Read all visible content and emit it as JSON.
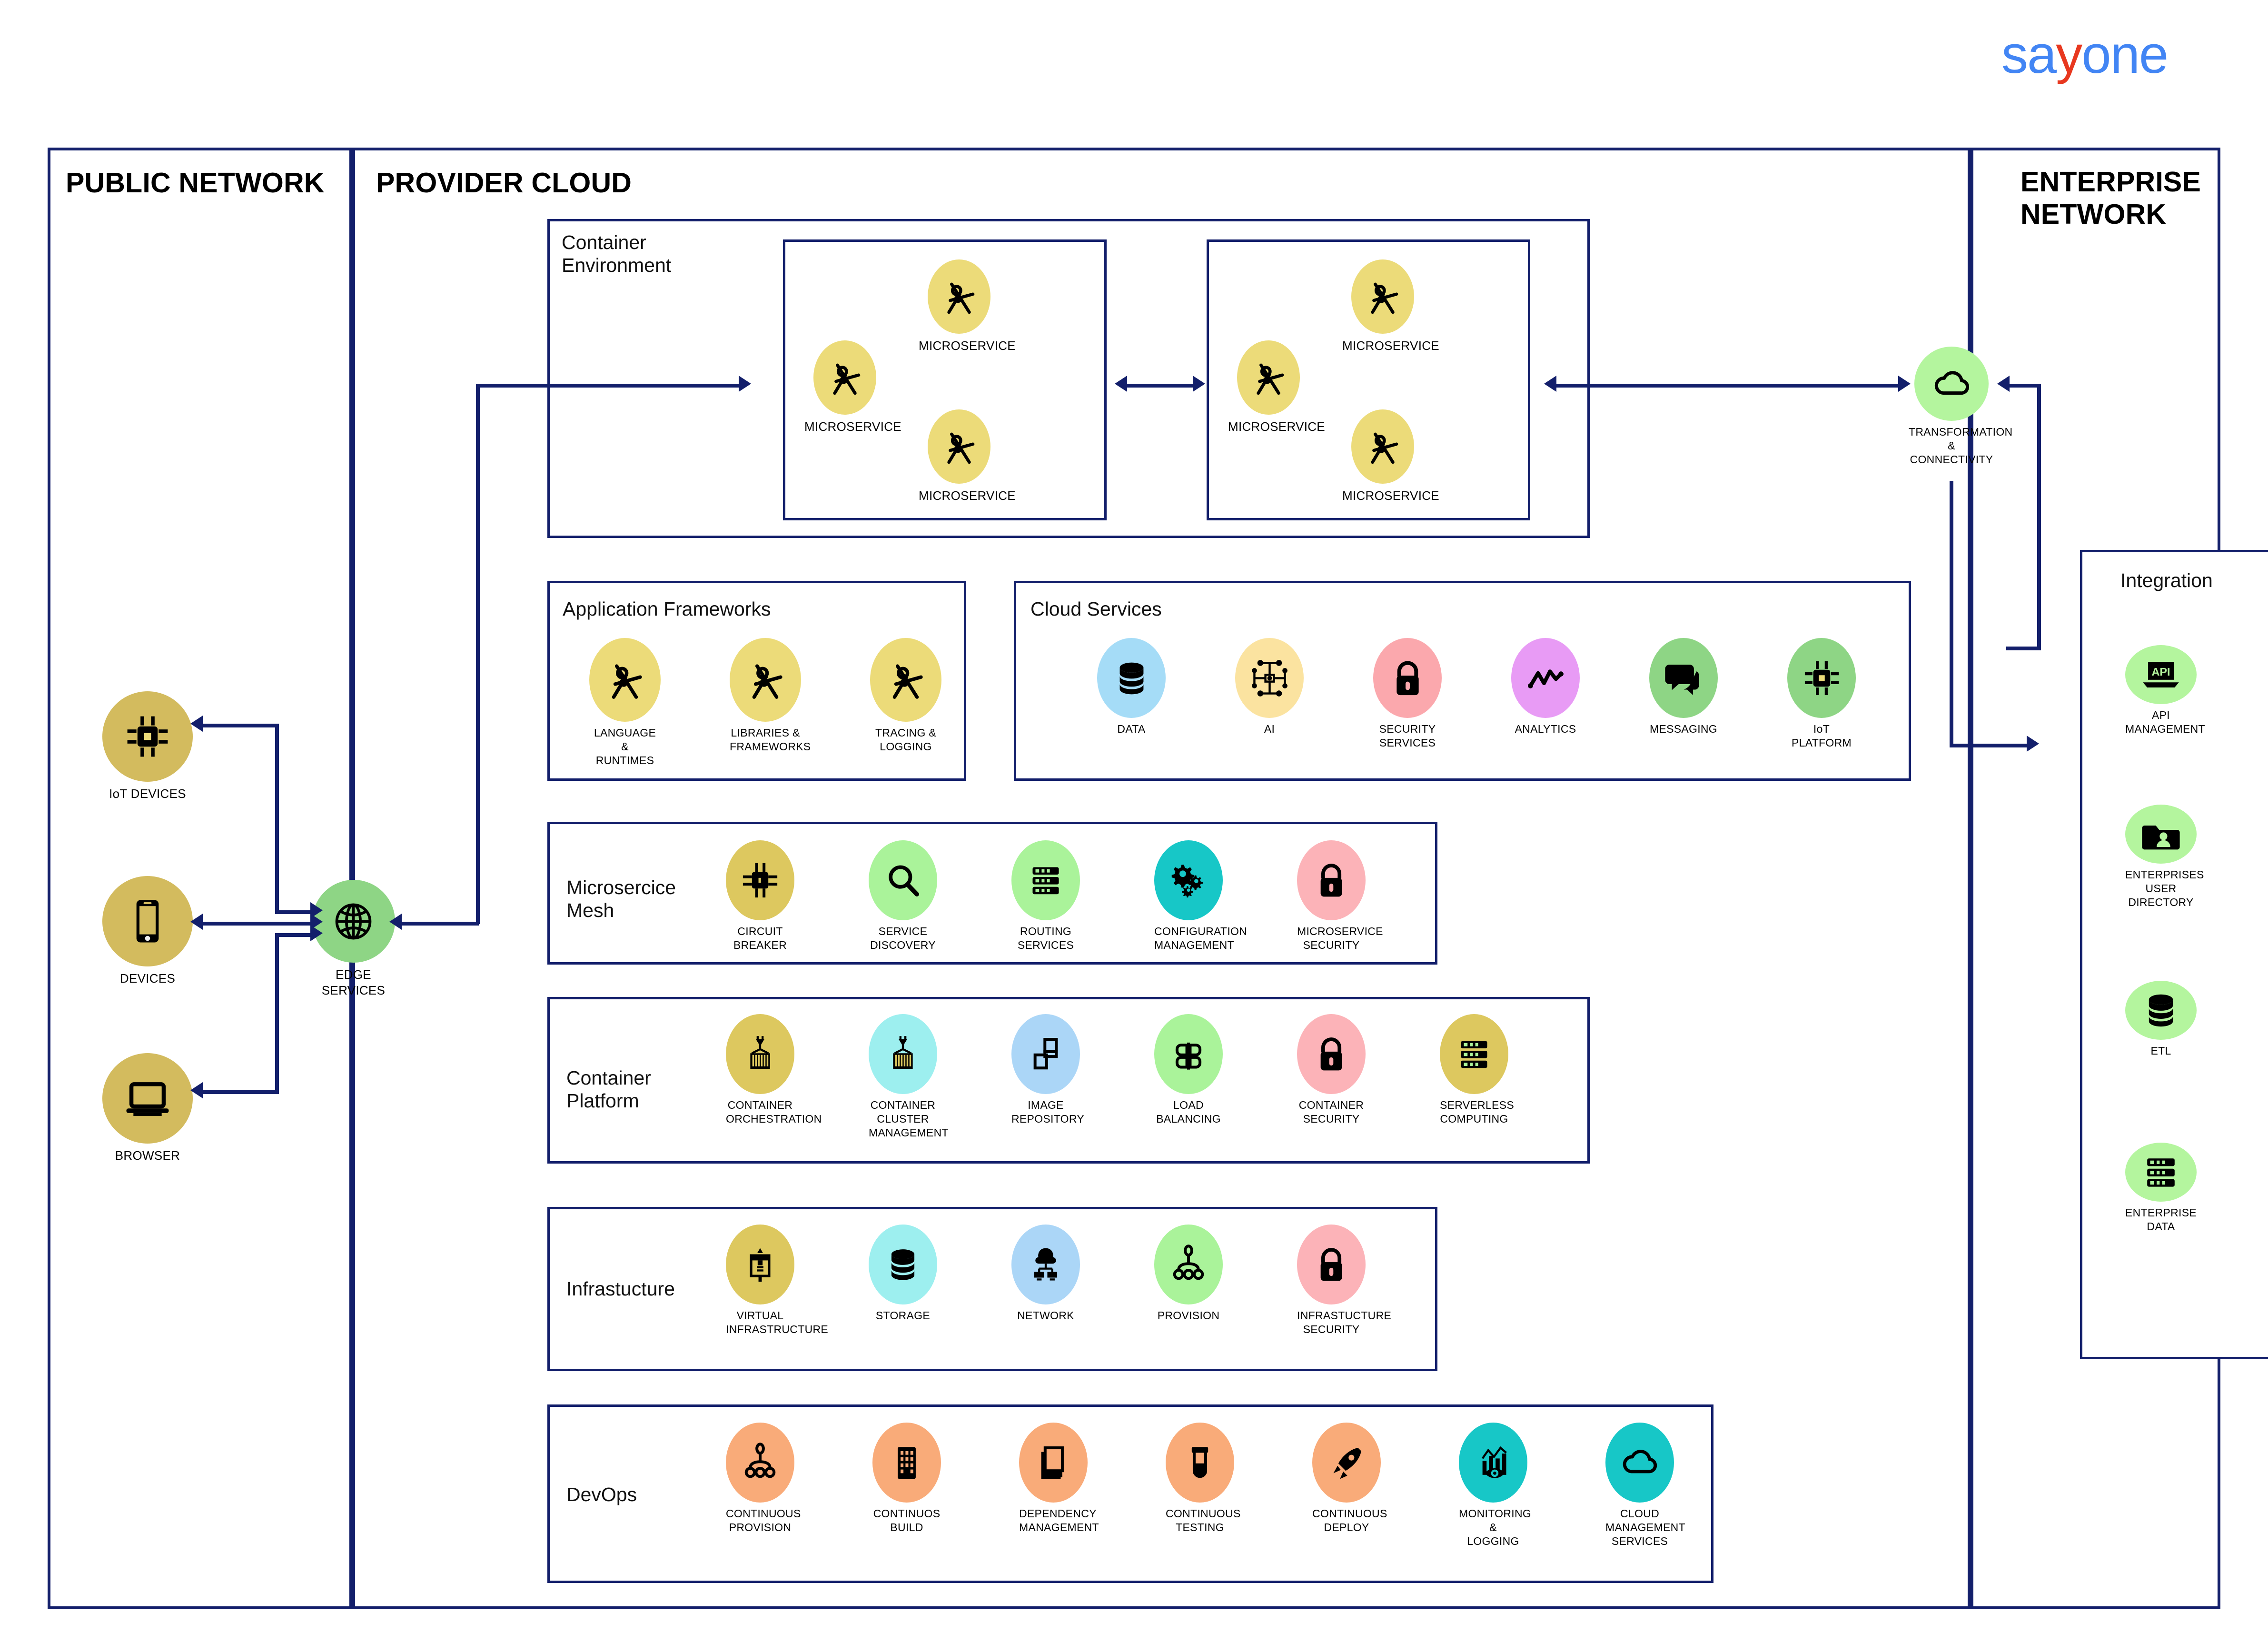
{
  "logo": {
    "text_a": "sa",
    "text_y": "y",
    "text_b": "one",
    "blue": "#4285f4",
    "red": "#e8381f"
  },
  "panels": {
    "public": {
      "title": "PUBLIC NETWORK"
    },
    "provider": {
      "title": "PROVIDER CLOUD"
    },
    "enterprise": {
      "title": "ENTERPRISE\nNETWORK"
    }
  },
  "public_nodes": [
    {
      "label": "IoT DEVICES",
      "icon": "chip-icon",
      "color": "#d3bb5e"
    },
    {
      "label": "DEVICES",
      "icon": "mobile-phone-icon",
      "color": "#d3bb5e"
    },
    {
      "label": "BROWSER",
      "icon": "laptop-icon",
      "color": "#d3bb5e"
    },
    {
      "label": "EDGE\nSERVICES",
      "icon": "globe-icon",
      "color": "#8ed585"
    }
  ],
  "container_environment": {
    "label": "Container\nEnvironment",
    "group_a": [
      {
        "label": "MICROSERVICE",
        "icon": "compass-divider-icon",
        "color": "#ecdb79"
      },
      {
        "label": "MICROSERVICE",
        "icon": "compass-divider-icon",
        "color": "#ecdb79"
      },
      {
        "label": "MICROSERVICE",
        "icon": "compass-divider-icon",
        "color": "#ecdb79"
      }
    ],
    "group_b": [
      {
        "label": "MICROSERVICE",
        "icon": "compass-divider-icon",
        "color": "#ecdb79"
      },
      {
        "label": "MICROSERVICE",
        "icon": "compass-divider-icon",
        "color": "#ecdb79"
      },
      {
        "label": "MICROSERVICE",
        "icon": "compass-divider-icon",
        "color": "#ecdb79"
      }
    ]
  },
  "application_frameworks": {
    "label": "Application Frameworks",
    "items": [
      {
        "label": "LANGUAGE &\nRUNTIMES",
        "icon": "compass-divider-icon",
        "color": "#ecdb79"
      },
      {
        "label": "LIBRARIES &\nFRAMEWORKS",
        "icon": "compass-divider-icon",
        "color": "#ecdb79"
      },
      {
        "label": "TRACING &\nLOGGING",
        "icon": "compass-divider-icon",
        "color": "#ecdb79"
      }
    ]
  },
  "cloud_services": {
    "label": "Cloud Services",
    "items": [
      {
        "label": "DATA",
        "icon": "database-icon",
        "color": "#a5dcf7"
      },
      {
        "label": "AI",
        "icon": "ai-chip-network-icon",
        "color": "#fbe3a0"
      },
      {
        "label": "SECURITY\nSERVICES",
        "icon": "padlock-icon",
        "color": "#fba8ad"
      },
      {
        "label": "ANALYTICS",
        "icon": "analytics-line-icon",
        "color": "#e89bf5"
      },
      {
        "label": "MESSAGING",
        "icon": "speech-bubbles-icon",
        "color": "#8ed585"
      },
      {
        "label": "IoT\nPLATFORM",
        "icon": "chip-icon",
        "color": "#8ed585"
      }
    ]
  },
  "microservice_mesh": {
    "label": "Microsercice\nMesh",
    "items": [
      {
        "label": "CIRCUIT\nBREAKER",
        "icon": "circuit-chip-icon",
        "color": "#ddc85f"
      },
      {
        "label": "SERVICE\nDISCOVERY",
        "icon": "magnifier-icon",
        "color": "#aaf39a"
      },
      {
        "label": "ROUTING\nSERVICES",
        "icon": "server-rack-icon",
        "color": "#aaf39a"
      },
      {
        "label": "CONFIGURATION\nMANAGEMENT",
        "icon": "gears-icon",
        "color": "#17c7c7"
      },
      {
        "label": "MICROSERVICE\nSECURITY",
        "icon": "padlock-icon",
        "color": "#fcb3b8"
      }
    ]
  },
  "container_platform": {
    "label": "Container\nPlatform",
    "items": [
      {
        "label": "CONTAINER\nORCHESTRATION",
        "icon": "shipping-container-crane-icon",
        "color": "#ddc85f"
      },
      {
        "label": "CONTAINER\nCLUSTER\nMANAGEMENT",
        "icon": "shipping-container-crane-icon",
        "color": "#9defef"
      },
      {
        "label": "IMAGE\nREPOSITORY",
        "icon": "blocks-stack-icon",
        "color": "#abd6f7"
      },
      {
        "label": "LOAD\nBALANCING",
        "icon": "load-balancer-icon",
        "color": "#aaf39a"
      },
      {
        "label": "CONTAINER\nSECURITY",
        "icon": "padlock-icon",
        "color": "#fcb3b8"
      },
      {
        "label": "SERVERLESS\nCOMPUTING",
        "icon": "server-rack-icon",
        "color": "#ddc85f"
      }
    ]
  },
  "infrastructure": {
    "label": "Infrastucture",
    "items": [
      {
        "label": "VIRTUAL\nINFRASTRUCTURE",
        "icon": "virtual-machine-icon",
        "color": "#ddc85f"
      },
      {
        "label": "STORAGE",
        "icon": "database-icon",
        "color": "#9defef"
      },
      {
        "label": "NETWORK",
        "icon": "network-tree-icon",
        "color": "#abd6f7"
      },
      {
        "label": "PROVISION",
        "icon": "provision-hierarchy-icon",
        "color": "#aaf39a"
      },
      {
        "label": "INFRASTUCTURE\nSECURITY",
        "icon": "padlock-icon",
        "color": "#fcb3b8"
      }
    ]
  },
  "devops": {
    "label": "DevOps",
    "items": [
      {
        "label": "CONTINUOUS\nPROVISION",
        "icon": "provision-hierarchy-icon",
        "color": "#f9ab79"
      },
      {
        "label": "CONTINUOS\nBUILD",
        "icon": "building-icon",
        "color": "#f9ab79"
      },
      {
        "label": "DEPENDENCY\nMANAGEMENT",
        "icon": "layers-copy-icon",
        "color": "#f9ab79"
      },
      {
        "label": "CONTINUOUS\nTESTING",
        "icon": "test-tube-icon",
        "color": "#f9ab79"
      },
      {
        "label": "CONTINUOUS\nDEPLOY",
        "icon": "rocket-icon",
        "color": "#f9ab79"
      },
      {
        "label": "MONITORING &\nLOGGING",
        "icon": "monitoring-chart-eye-icon",
        "color": "#17c7c7"
      },
      {
        "label": "CLOUD\nMANAGEMENT\nSERVICES",
        "icon": "cloud-icon",
        "color": "#17c7c7"
      }
    ]
  },
  "transformation": {
    "label": "TRANSFORMATION\n& CONNECTIVITY",
    "icon": "cloud-icon",
    "color": "#b4f59e"
  },
  "integration": {
    "label": "Integration",
    "items": [
      {
        "label": "API\nMANAGEMENT",
        "icon": "api-laptop-icon",
        "color": "#b4f59e"
      },
      {
        "label": "ENTERPRISES\nUSER DIRECTORY",
        "icon": "user-folder-icon",
        "color": "#b4f59e"
      },
      {
        "label": "ETL",
        "icon": "database-icon",
        "color": "#b4f59e"
      },
      {
        "label": "ENTERPRISE\nDATA",
        "icon": "server-rack-icon",
        "color": "#b4f59e"
      }
    ]
  },
  "colors": {
    "line": "#131f6b",
    "border": "#131f6b",
    "background": "#ffffff"
  }
}
